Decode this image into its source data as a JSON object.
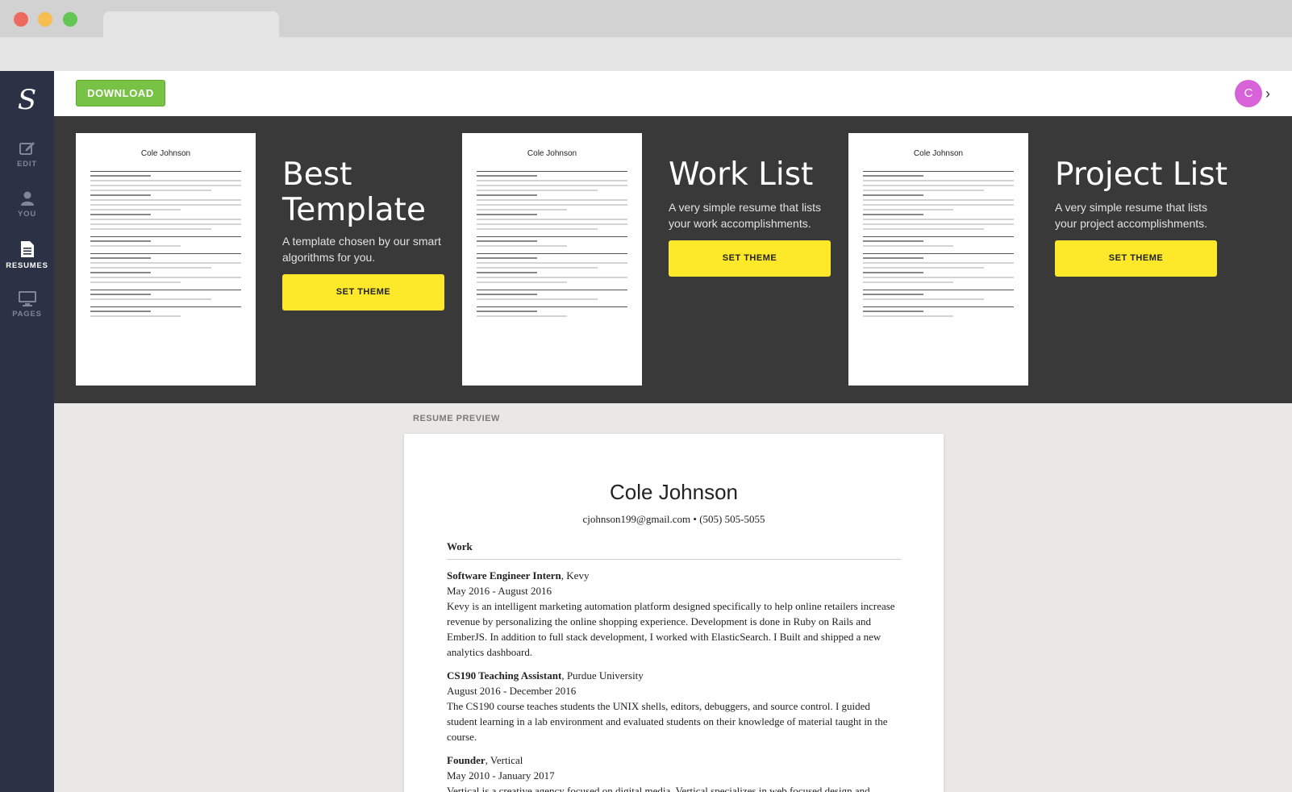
{
  "topbar": {
    "download_label": "DOWNLOAD",
    "avatar_initial": "C",
    "avatar_color": "#d862d8"
  },
  "sidebar": {
    "logo": "S",
    "items": [
      {
        "label": "EDIT",
        "icon": "edit-icon",
        "active": false
      },
      {
        "label": "YOU",
        "icon": "user-icon",
        "active": false
      },
      {
        "label": "RESUMES",
        "icon": "document-icon",
        "active": true
      },
      {
        "label": "PAGES",
        "icon": "monitor-icon",
        "active": false
      }
    ]
  },
  "themes": [
    {
      "title": "Best Template",
      "description": "A template chosen by our smart algorithms for you.",
      "button": "SET THEME",
      "thumb_name": "Cole Johnson"
    },
    {
      "title": "Work List",
      "description": "A very simple resume that lists your work accomplishments.",
      "button": "SET THEME",
      "thumb_name": "Cole Johnson"
    },
    {
      "title": "Project List",
      "description": "A very simple resume that lists your project accomplishments.",
      "button": "SET THEME",
      "thumb_name": "Cole Johnson"
    }
  ],
  "preview": {
    "label": "RESUME PREVIEW",
    "name": "Cole Johnson",
    "contact": "cjohnson199@gmail.com • (505) 505-5055",
    "section": "Work",
    "entries": [
      {
        "role": "Software Engineer Intern",
        "org": ", Kevy",
        "dates": "May 2016 - August 2016",
        "description": "Kevy is an intelligent marketing automation platform designed specifically to help online retailers increase revenue by personalizing the online shopping experience. Development is done in Ruby on Rails and EmberJS. In addition to full stack development, I worked with ElasticSearch. I Built and shipped a new analytics dashboard."
      },
      {
        "role": "CS190 Teaching Assistant",
        "org": ", Purdue University",
        "dates": "August 2016 - December 2016",
        "description": "The CS190 course teaches students the UNIX shells, editors, debuggers, and source control. I guided student learning in a lab environment and evaluated students on their knowledge of material taught in the course."
      },
      {
        "role": "Founder",
        "org": ", Vertical",
        "dates": "May 2010 - January 2017",
        "description": "Vertical is a creative agency focused on digital media. Vertical specializes in web focused design and development, producing films, and still photography. As CEO, I manage clients and deal directly with their needs to meet their creative vision. I also directly oversee the production of client projects."
      }
    ]
  },
  "colors": {
    "sidebar": "#2b3245",
    "download": "#78c245",
    "set_theme": "#fde82a",
    "themes_band": "#393939"
  }
}
